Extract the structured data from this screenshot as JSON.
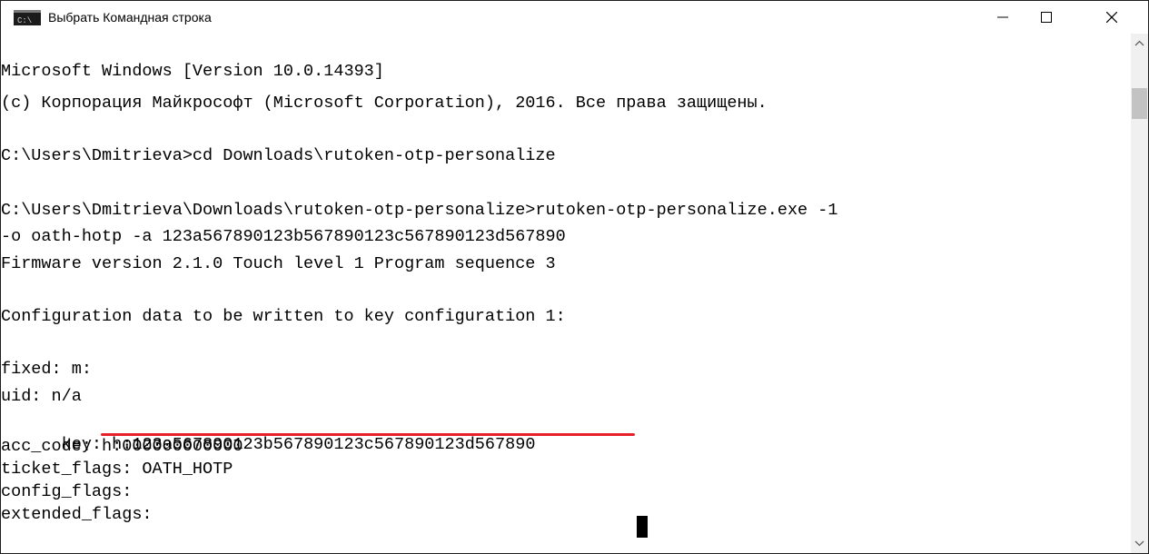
{
  "window": {
    "title": "Выбрать Командная строка",
    "icon": "cmd-icon",
    "icon_text": "C:\\"
  },
  "console": {
    "lines": [
      "Microsoft Windows [Version 10.0.14393]",
      "(c) Корпорация Майкрософт (Microsoft Corporation), 2016. Все права защищены.",
      "",
      "C:\\Users\\Dmitrieva>cd Downloads\\rutoken-otp-personalize",
      "",
      "C:\\Users\\Dmitrieva\\Downloads\\rutoken-otp-personalize>rutoken-otp-personalize.exe -1",
      "-o oath-hotp -a 123a567890123b567890123c567890123d567890",
      "Firmware version 2.1.0 Touch level 1 Program sequence 3",
      "",
      "Configuration data to be written to key configuration 1:",
      "",
      "fixed: m:",
      "uid: n/a"
    ],
    "key_prefix": "key: h:",
    "key_value": "123a567890123b567890123c567890123d567890",
    "after_lines": [
      "acc_code: h:000000000000",
      "ticket_flags: OATH_HOTP",
      "config_flags:",
      "extended_flags:"
    ]
  },
  "colors": {
    "highlight": "#e8202a",
    "text": "#000000",
    "background": "#ffffff"
  }
}
